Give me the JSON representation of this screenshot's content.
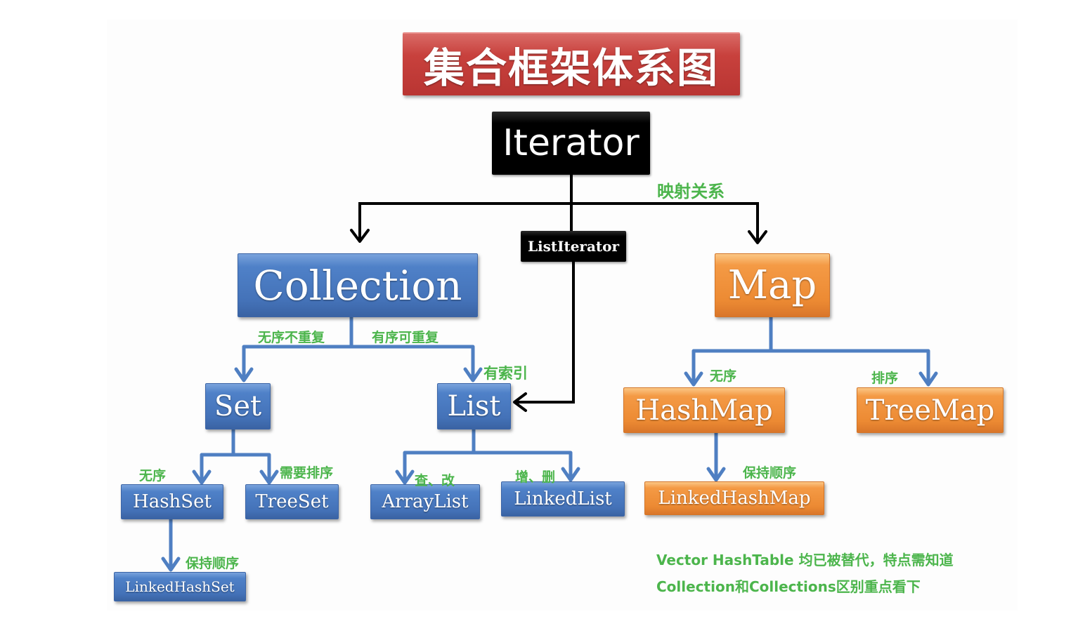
{
  "title": "集合框架体系图",
  "nodes": {
    "iterator": "Iterator",
    "list_iterator": "ListIterator",
    "collection": "Collection",
    "map": "Map",
    "set": "Set",
    "list": "List",
    "hash_set": "HashSet",
    "tree_set": "TreeSet",
    "linked_hash_set": "LinkedHashSet",
    "array_list": "ArrayList",
    "linked_list": "LinkedList",
    "hash_map": "HashMap",
    "tree_map": "TreeMap",
    "linked_hash_map": "LinkedHashMap"
  },
  "edge_labels": {
    "mapping_relation": "映射关系",
    "unordered_no_duplicates": "无序不重复",
    "ordered_duplicates": "有序可重复",
    "indexed": "有索引",
    "set_unordered": "无序",
    "needs_sorting": "需要排序",
    "set_keeps_order": "保持顺序",
    "query_modify": "查、改",
    "add_delete": "增、删",
    "map_unordered": "无序",
    "map_sorted": "排序",
    "map_keeps_order": "保持顺序"
  },
  "notes": [
    "Vector HashTable 均已被替代，特点需知道",
    "Collection和Collections区别重点看下"
  ],
  "colors": {
    "title": "#c0403c",
    "interface_black": "#000000",
    "collection_blue": "#4a7bc0",
    "map_orange": "#f0903a",
    "label_green": "#4cb54c",
    "connector_blue": "#4f7fc2",
    "connector_black": "#000000"
  }
}
